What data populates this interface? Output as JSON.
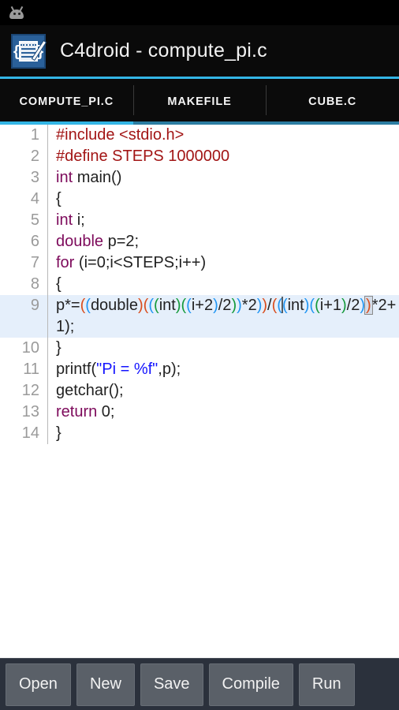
{
  "statusbar": {
    "icon": "android-head-icon"
  },
  "titlebar": {
    "icon": "c4droid-app-icon",
    "title": "C4droid - compute_pi.c",
    "accent_color": "#33b5e5"
  },
  "tabs": [
    {
      "label": "COMPUTE_PI.C",
      "active": true
    },
    {
      "label": "MAKEFILE",
      "active": false
    },
    {
      "label": "CUBE.C",
      "active": false
    }
  ],
  "editor": {
    "filename": "compute_pi.c",
    "highlight_color": "#e5effb",
    "cursor_line": 9,
    "lines": [
      {
        "num": "1",
        "text": "#include <stdio.h>"
      },
      {
        "num": "2",
        "text": "#define STEPS 1000000"
      },
      {
        "num": "3",
        "text": "int main()"
      },
      {
        "num": "4",
        "text": "{"
      },
      {
        "num": "5",
        "text": "int i;"
      },
      {
        "num": "6",
        "text": "double p=2;"
      },
      {
        "num": "7",
        "text": "for (i=0;i<STEPS;i++)"
      },
      {
        "num": "8",
        "text": "{"
      },
      {
        "num": "9",
        "text": "p*=((double)(((int)((i+2)/2))*2))/(((int)((i+1)/2))*2+1);"
      },
      {
        "num": "10",
        "text": "}"
      },
      {
        "num": "11",
        "text": "printf(\"Pi = %f\",p);"
      },
      {
        "num": "12",
        "text": "getchar();"
      },
      {
        "num": "13",
        "text": "return 0;"
      },
      {
        "num": "14",
        "text": "}"
      }
    ],
    "line9_segments": [
      {
        "t": "p*=",
        "c": "plain"
      },
      {
        "t": "(",
        "c": "p0"
      },
      {
        "t": "(",
        "c": "p1"
      },
      {
        "t": "double",
        "c": "plain"
      },
      {
        "t": ")",
        "c": "p0"
      },
      {
        "t": "(",
        "c": "p0"
      },
      {
        "t": "(",
        "c": "p1"
      },
      {
        "t": "(",
        "c": "p2"
      },
      {
        "t": "int",
        "c": "plain"
      },
      {
        "t": ")",
        "c": "p2"
      },
      {
        "t": "(",
        "c": "p2"
      },
      {
        "t": "(",
        "c": "p1"
      },
      {
        "t": "i+2",
        "c": "plain"
      },
      {
        "t": ")",
        "c": "p1"
      },
      {
        "t": "/2",
        "c": "plain"
      },
      {
        "t": ")",
        "c": "p2"
      },
      {
        "t": ")",
        "c": "p1"
      },
      {
        "t": "*2",
        "c": "plain"
      },
      {
        "t": ")",
        "c": "p1"
      },
      {
        "t": ")",
        "c": "p0"
      },
      {
        "t": "/",
        "c": "plain"
      },
      {
        "t": "(",
        "c": "p0"
      },
      {
        "t": "(",
        "c": "p1"
      },
      {
        "t": "(",
        "c": "p1"
      },
      {
        "t": "int",
        "c": "plain"
      },
      {
        "t": ")",
        "c": "p1"
      },
      {
        "t": "(",
        "c": "p1"
      },
      {
        "t": "(",
        "c": "p2"
      },
      {
        "t": "i+1",
        "c": "plain"
      },
      {
        "t": ")",
        "c": "p2"
      },
      {
        "t": "/2",
        "c": "plain"
      },
      {
        "t": ")",
        "c": "p1"
      },
      {
        "t": ")",
        "c": "p0"
      },
      {
        "t": "*2+1",
        "c": "plain"
      },
      {
        "t": ")",
        "c": "plain"
      },
      {
        "t": ";",
        "c": "plain"
      }
    ]
  },
  "bottombar": {
    "buttons": [
      {
        "label": "Open"
      },
      {
        "label": "New"
      },
      {
        "label": "Save"
      },
      {
        "label": "Compile"
      },
      {
        "label": "Run"
      }
    ]
  }
}
